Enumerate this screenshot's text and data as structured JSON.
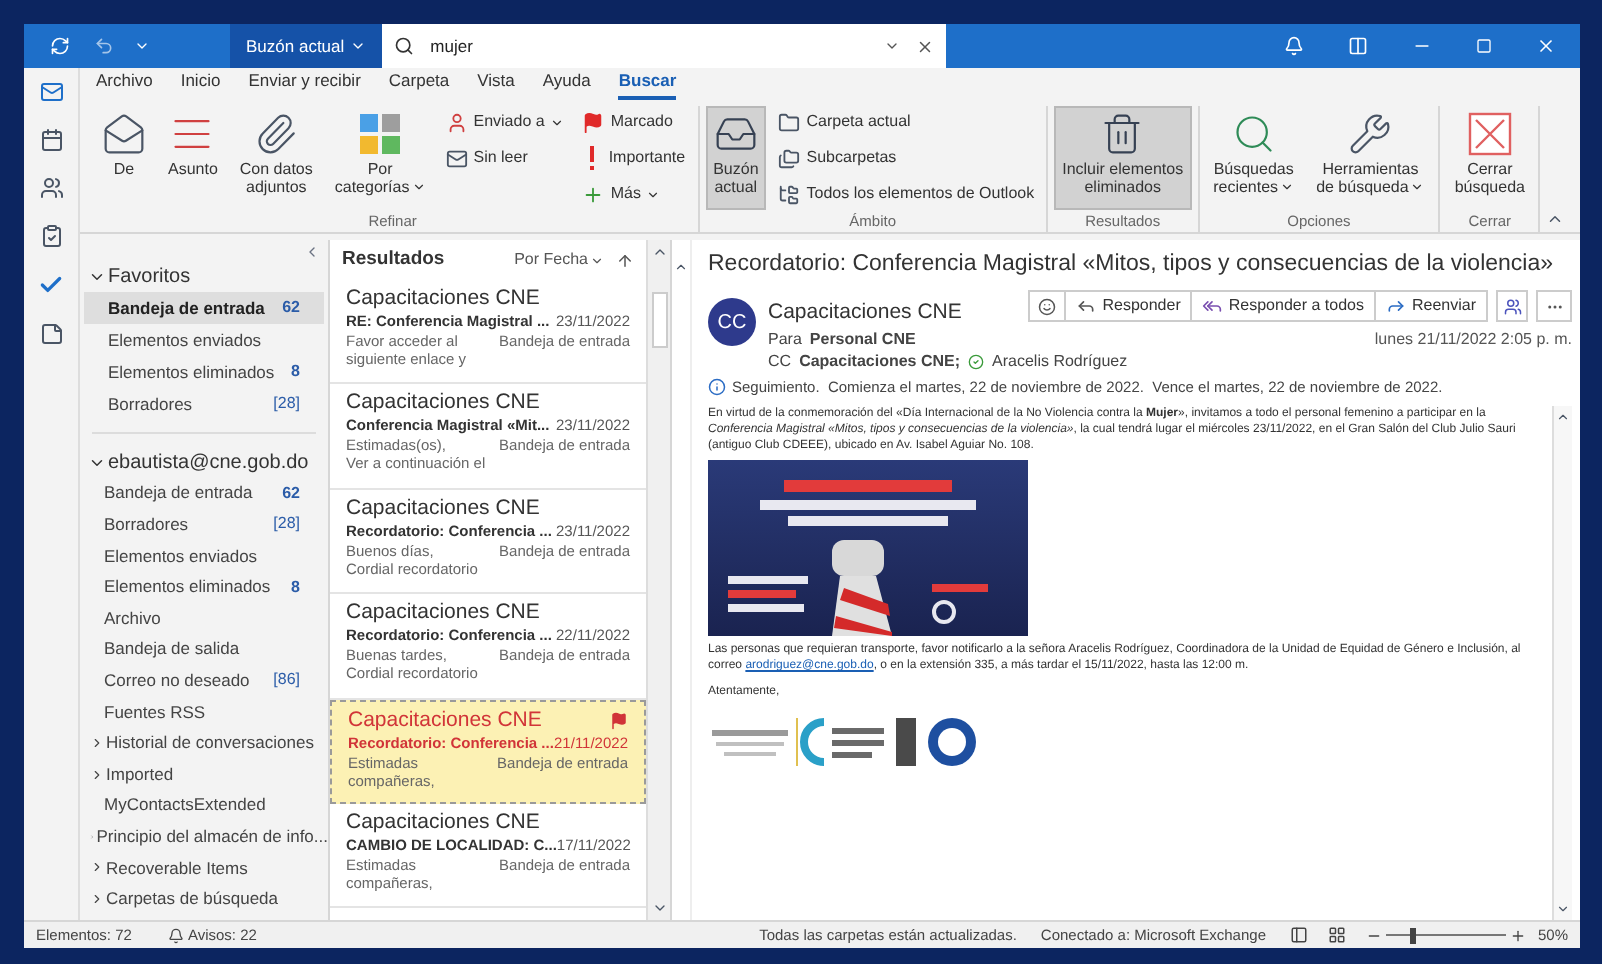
{
  "title_bar": {
    "scope": "Buzón actual",
    "search": {
      "value": "mujer"
    }
  },
  "ribbon": {
    "tabs": [
      {
        "label": "Archivo",
        "selected": false
      },
      {
        "label": "Inicio",
        "selected": false
      },
      {
        "label": "Enviar y recibir",
        "selected": false
      },
      {
        "label": "Carpeta",
        "selected": false
      },
      {
        "label": "Vista",
        "selected": false
      },
      {
        "label": "Ayuda",
        "selected": false
      },
      {
        "label": "Buscar",
        "selected": true
      }
    ],
    "groups": [
      {
        "label": "Refinar",
        "columns": [
          [
            {
              "kind": "large",
              "label": "De",
              "dropdown": false,
              "selected": false
            }
          ],
          [
            {
              "kind": "large",
              "label": "Asunto",
              "dropdown": false,
              "selected": false
            }
          ],
          [
            {
              "kind": "large",
              "label": "Con datos\nadjuntos",
              "dropdown": false,
              "selected": false
            }
          ],
          [
            {
              "kind": "large",
              "label": "Por\ncategorías",
              "dropdown": true,
              "selected": false
            }
          ],
          [
            {
              "kind": "small",
              "label": "Enviado a",
              "dropdown": true,
              "selected": false
            },
            {
              "kind": "small",
              "label": "Sin leer",
              "dropdown": false,
              "selected": false
            }
          ],
          [
            {
              "kind": "small",
              "label": "Marcado",
              "dropdown": false,
              "selected": false
            },
            {
              "kind": "small",
              "label": "Importante",
              "dropdown": false,
              "selected": false
            },
            {
              "kind": "small",
              "label": "Más",
              "dropdown": true,
              "selected": false
            }
          ]
        ]
      },
      {
        "label": "Ámbito",
        "columns": [
          [
            {
              "kind": "large",
              "label": "Buzón\nactual",
              "dropdown": false,
              "selected": true
            }
          ],
          [
            {
              "kind": "small",
              "label": "Carpeta actual",
              "dropdown": false,
              "selected": false
            },
            {
              "kind": "small",
              "label": "Subcarpetas",
              "dropdown": false,
              "selected": false
            },
            {
              "kind": "small",
              "label": "Todos los elementos de Outlook",
              "dropdown": false,
              "selected": false
            }
          ]
        ]
      },
      {
        "label": "Resultados",
        "columns": [
          [
            {
              "kind": "large",
              "label": "Incluir elementos\neliminados",
              "dropdown": false,
              "selected": true
            }
          ]
        ]
      },
      {
        "label": "Opciones",
        "columns": [
          [
            {
              "kind": "large",
              "label": "Búsquedas\nrecientes",
              "dropdown": true,
              "selected": false
            }
          ],
          [
            {
              "kind": "large",
              "label": "Herramientas\nde búsqueda",
              "dropdown": true,
              "selected": false
            }
          ]
        ]
      },
      {
        "label": "Cerrar",
        "columns": [
          [
            {
              "kind": "large",
              "label": "Cerrar\nbúsqueda",
              "dropdown": false,
              "selected": false
            }
          ]
        ]
      }
    ]
  },
  "folders": {
    "favorites": {
      "label": "Favoritos",
      "expanded": true,
      "items": [
        {
          "name": "Bandeja de entrada",
          "count": "62",
          "selected": true
        },
        {
          "name": "Elementos enviados",
          "selected": false
        },
        {
          "name": "Elementos eliminados",
          "count": "8",
          "selected": false
        },
        {
          "name": "Borradores",
          "count": "[28]",
          "selected": false
        }
      ]
    },
    "account": {
      "label": "ebautista@cne.gob.do",
      "expanded": true,
      "items": [
        {
          "kind": "folder",
          "name": "Bandeja de entrada",
          "count": "62"
        },
        {
          "kind": "folder",
          "name": "Borradores",
          "count": "[28]"
        },
        {
          "kind": "folder",
          "name": "Elementos enviados"
        },
        {
          "kind": "folder",
          "name": "Elementos eliminados",
          "count": "8"
        },
        {
          "kind": "folder",
          "name": "Archivo"
        },
        {
          "kind": "folder",
          "name": "Bandeja de salida"
        },
        {
          "kind": "folder",
          "name": "Correo no deseado",
          "count": "[86]"
        },
        {
          "kind": "folder",
          "name": "Fuentes RSS"
        },
        {
          "kind": "collapsed",
          "name": "Historial de conversaciones"
        },
        {
          "kind": "collapsed",
          "name": "Imported"
        },
        {
          "kind": "folder",
          "name": "MyContactsExtended"
        },
        {
          "kind": "collapsed",
          "name": "Principio del almacén de info..."
        },
        {
          "kind": "collapsed",
          "name": "Recoverable Items"
        },
        {
          "kind": "collapsed",
          "name": "Carpetas de búsqueda"
        }
      ]
    }
  },
  "messages": {
    "title": "Resultados",
    "sort": "Por Fecha",
    "items": [
      {
        "sender": "Capacitaciones CNE",
        "subject": "RE: Conferencia Magistral ...",
        "date": "23/11/2022",
        "preview": [
          "Favor acceder al",
          "siguiente enlace y"
        ],
        "folder": "Bandeja de entrada",
        "selected": false,
        "flagged": false
      },
      {
        "sender": "Capacitaciones CNE",
        "subject": "Conferencia Magistral «Mit...",
        "date": "23/11/2022",
        "preview": [
          "Estimadas(os),",
          "Ver a continuación el"
        ],
        "folder": "Bandeja de entrada",
        "selected": false,
        "flagged": false
      },
      {
        "sender": "Capacitaciones CNE",
        "subject": "Recordatorio: Conferencia ...",
        "date": "23/11/2022",
        "preview": [
          "Buenos días,",
          "Cordial recordatorio"
        ],
        "folder": "Bandeja de entrada",
        "selected": false,
        "flagged": false
      },
      {
        "sender": "Capacitaciones CNE",
        "subject": "Recordatorio: Conferencia ...",
        "date": "22/11/2022",
        "preview": [
          "Buenas tardes,",
          "Cordial recordatorio"
        ],
        "folder": "Bandeja de entrada",
        "selected": false,
        "flagged": false
      },
      {
        "sender": "Capacitaciones CNE",
        "subject": "Recordatorio: Conferencia ...",
        "date": "21/11/2022",
        "preview": [
          "Estimadas",
          "compañeras,"
        ],
        "folder": "Bandeja de entrada",
        "selected": true,
        "flagged": true
      },
      {
        "sender": "Capacitaciones CNE",
        "subject": "CAMBIO DE LOCALIDAD: C...",
        "date": "17/11/2022",
        "preview": [
          "Estimadas",
          "compañeras,"
        ],
        "folder": "Bandeja de entrada",
        "selected": false,
        "flagged": false
      }
    ]
  },
  "reading": {
    "subject": "Recordatorio: Conferencia Magistral «Mitos, tipos y consecuencias de la violencia»",
    "avatar": "CC",
    "sender": "Capacitaciones CNE",
    "to_label": "Para",
    "to": "Personal CNE",
    "cc_label": "CC",
    "cc": [
      "Capacitaciones CNE;",
      "Aracelis Rodríguez"
    ],
    "actions": [
      "Responder",
      "Responder a todos",
      "Reenviar"
    ],
    "date": "lunes 21/11/2022 2:05 p. m.",
    "followup": "Seguimiento.  Comienza el martes, 22 de noviembre de 2022.  Vence el martes, 22 de noviembre de 2022.",
    "body": {
      "paragraph_1": "En virtud de la conmemoración del «Día Internacional de la No Violencia contra la **Mujer**», invitamos a todo el personal femenino a participar en la *Conferencia Magistral «Mitos, tipos y consecuencias de la violencia»*, la cual tendrá lugar el miércoles 23/11/2022, en el Gran Salón del Club Julio Sauri (antiguo Club CDEEE), ubicado en Av. Isabel Aguiar No. 108.",
      "paragraph_2": {
        "before": "Las personas que requieran transporte, favor notificarlo a la señora Aracelis Rodríguez, Coordinadora de la Unidad de Equidad de Género e Inclusión, al correo",
        "link": "arodriguez@cne.gob.do",
        "after": ", o en la extensión 335, a más tardar el 15/11/2022, hasta las 12:00 m."
      },
      "closing": "Atentamente,"
    }
  },
  "status_bar": {
    "items": "Elementos: 72",
    "reminders": "Avisos: 22",
    "sync": "Todas las carpetas están actualizadas.",
    "connection": "Conectado a: Microsoft Exchange",
    "zoom": {
      "level": 0.22,
      "reading": "50%"
    }
  }
}
